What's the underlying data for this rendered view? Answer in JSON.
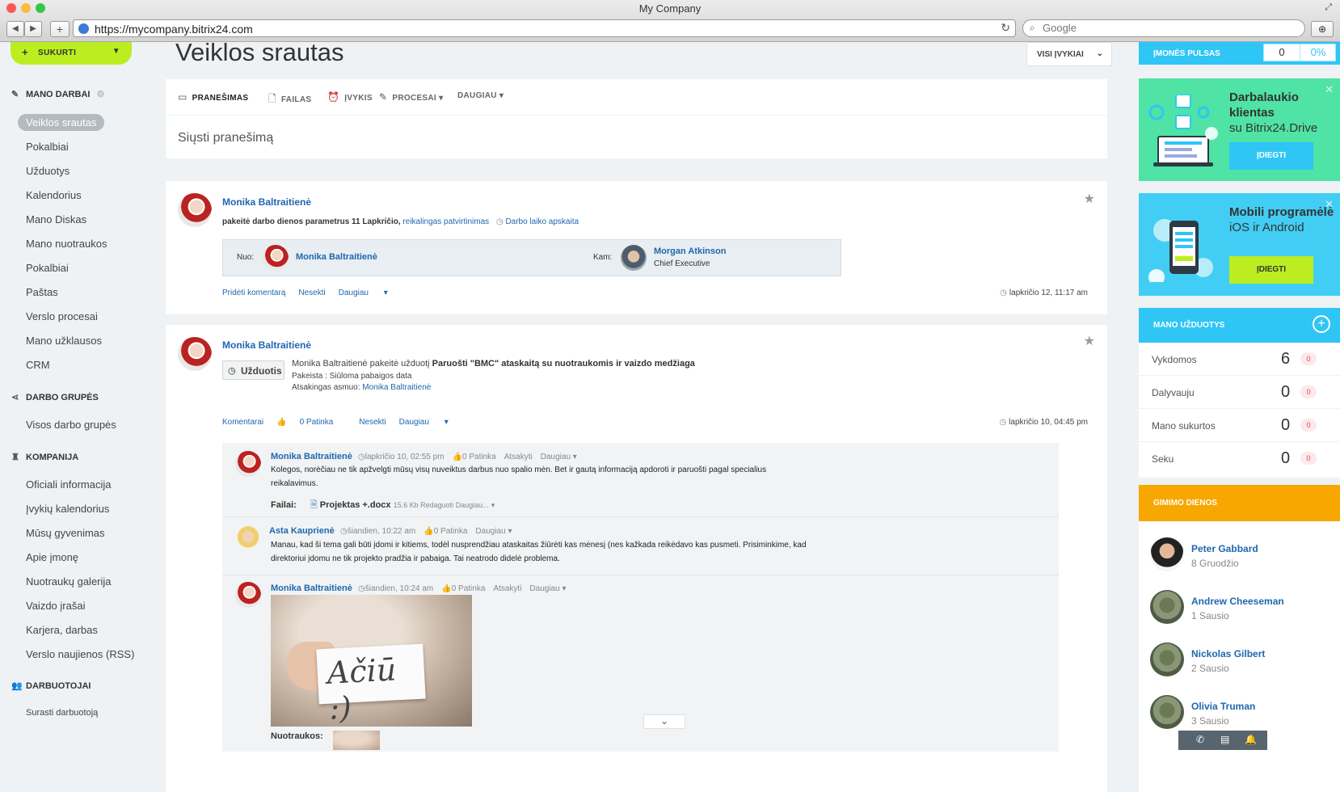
{
  "browser": {
    "title": "My Company",
    "url": "https://mycompany.bitrix24.com",
    "search_placeholder": "Google"
  },
  "sidebar": {
    "create_label": "SUKURTI",
    "my_works": "MANO DARBAI",
    "items": [
      "Veiklos srautas",
      "Pokalbiai",
      "Užduotys",
      "Kalendorius",
      "Mano Diskas",
      "Mano nuotraukos",
      "Pokalbiai",
      "Paštas",
      "Verslo procesai",
      "Mano užklausos",
      "CRM"
    ],
    "groups_title": "DARBO GRUPĖS",
    "groups_items": [
      "Visos darbo grupės"
    ],
    "company_title": "KOMPANIJA",
    "company_items": [
      "Oficiali informacija",
      "Įvykių kalendorius",
      "Mūsų gyvenimas",
      "Apie įmonę",
      "Nuotraukų galerija",
      "Vaizdo įrašai",
      "Karjera, darbas",
      "Verslo naujienos (RSS)"
    ],
    "employees_title": "DARBUOTOJAI",
    "employees_items": [
      "Surasti darbuotoją"
    ]
  },
  "main": {
    "title": "Veiklos srautas",
    "filter_label": "VISI ĮVYKIAI",
    "tabs": [
      "PRANEŠIMAS",
      "FAILAS",
      "ĮVYKIS",
      "PROCESAI",
      "DAUGIAU"
    ],
    "placeholder": "Siųsti pranešimą",
    "post1": {
      "author": "Monika Baltraitienė",
      "text_plain": "pakeitė darbo dienos parametrus 11 Lapkričio,",
      "text_link": "reikalingas patvirtinimas",
      "timeman": "Darbo laiko apskaita",
      "from_label": "Nuo:",
      "from_name": "Monika Baltraitienė",
      "to_label": "Kam:",
      "to_name": "Morgan Atkinson",
      "to_position": "Chief Executive",
      "actions": [
        "Pridėti komentarą",
        "Nesekti",
        "Daugiau"
      ],
      "date": "lapkričio 12, 11:17 am"
    },
    "post2": {
      "author": "Monika Baltraitienė",
      "badge": "Užduotis",
      "line1_plain": "Monika Baltraitienė pakeitė užduotį",
      "line1_link": "Paruošti \"BMC\" ataskaitą su nuotraukomis ir vaizdo medžiaga",
      "line2": "Pakeista :  Siūloma pabaigos data",
      "line3_label": "Atsakingas asmuo:",
      "line3_link": "Monika Baltraitienė",
      "actions": [
        "Komentarai",
        "0 Patinka",
        "Nesekti",
        "Daugiau"
      ],
      "date": "lapkričio 10, 04:45 pm"
    },
    "comments": [
      {
        "author": "Monika Baltraitienė",
        "time": "lapkričio 10, 02:55 pm",
        "likes": "0 Patinka",
        "reply": "Atsakyti",
        "more": "Daugiau",
        "text1": "Kolegos, norėčiau ne tik apžvelgti mūsų visų nuveiktus darbus nuo spalio mėn. Bet ir gautą informaciją apdoroti ir paruošti pagal specialius",
        "text2": "reikalavimus.",
        "files_label": "Failai:",
        "file_name": "Projektas +.docx",
        "file_meta": "15.6 Kb Redaguoti  Daugiau..."
      },
      {
        "author": "Asta Kauprienė",
        "time": "šiandien, 10:22 am",
        "likes": "0 Patinka",
        "more": "Daugiau",
        "text1": "Manau, kad ši tema gali būti įdomi ir kitiems, todėl nusprendžiau ataskaitas žiūrėti kas mėnesį (nes kažkada reikėdavo kas pusmeti. Prisiminkime, kad",
        "text2": "direktoriui įdomu ne tik projekto pradžia ir pabaiga. Tai neatrodo didelė problema."
      },
      {
        "author": "Monika Baltraitienė",
        "time": "šiandien, 10:24 am",
        "likes": "0 Patinka",
        "reply": "Atsakyti",
        "more": "Daugiau",
        "photo_text": "Ačiū :)",
        "photos_label": "Nuotraukos:"
      }
    ]
  },
  "right": {
    "pulse_label": "ĮMONĖS PULSAS",
    "pulse_value": "0",
    "pulse_pct": "0%",
    "promo1": {
      "title": "Darbalaukio klientas",
      "sub": "su Bitrix24.Drive",
      "button": "ĮDIEGTI",
      "bg": "#4fe3a6",
      "btn_bg": "#2fc6f6"
    },
    "promo2": {
      "title": "Mobili programėlė",
      "sub": "iOS ir Android",
      "button": "ĮDIEGTI",
      "bg": "#42cef4",
      "btn_bg": "#bbed21"
    },
    "tasks_title": "MANO UŽDUOTYS",
    "tasks": [
      {
        "label": "Vykdomos",
        "count": "6",
        "badge": "0"
      },
      {
        "label": "Dalyvauju",
        "count": "0",
        "badge": "0"
      },
      {
        "label": "Mano sukurtos",
        "count": "0",
        "badge": "0"
      },
      {
        "label": "Seku",
        "count": "0",
        "badge": "0"
      }
    ],
    "bdays_title": "GIMIMO DIENOS",
    "bdays": [
      {
        "name": "Peter Gabbard",
        "date": "8 Gruodžio"
      },
      {
        "name": "Andrew Cheeseman",
        "date": "1 Sausio"
      },
      {
        "name": "Nickolas Gilbert",
        "date": "2 Sausio"
      },
      {
        "name": "Olivia Truman",
        "date": "3 Sausio"
      }
    ]
  },
  "colors": {
    "accent": "#2fc6f6",
    "create": "#bbed21",
    "birthdays": "#f7a700",
    "link": "#2067b0"
  }
}
